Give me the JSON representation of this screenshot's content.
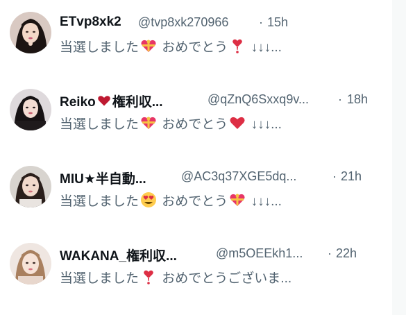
{
  "tweets": [
    {
      "name": "ETvp8xk2",
      "handle": "@tvp8xk270966",
      "separator": "·",
      "time": "15h",
      "text_a": "当選しました",
      "text_b": "おめでとう",
      "text_c": "↓↓↓...",
      "emoji_a": "gift-heart-icon",
      "emoji_b": "exclamation-heart-icon"
    },
    {
      "name": "Reiko",
      "name_suffix": "権利収...",
      "handle": "@qZnQ6Sxxq9v...",
      "separator": "·",
      "time": "18h",
      "text_a": "当選しました",
      "text_b": "おめでとう",
      "text_c": "↓↓↓...",
      "emoji_a": "gift-heart-icon",
      "emoji_b": "red-heart-icon"
    },
    {
      "name": "MIU★半自動...",
      "handle": "@AC3q37XGE5dq...",
      "separator": "·",
      "time": "21h",
      "text_a": "当選しました",
      "text_b": "おめでとう",
      "text_c": "↓↓↓...",
      "emoji_a": "heart-eyes-icon",
      "emoji_b": "gift-heart-icon"
    },
    {
      "name": "WAKANA_権利収...",
      "handle": "@m5OEEkh1...",
      "separator": "·",
      "time": "22h",
      "text_a": "当選しました",
      "text_b": "おめでとうございま...",
      "emoji_a": "exclamation-heart-icon"
    }
  ],
  "colors": {
    "name": "#0f1419",
    "secondary": "#536471",
    "heart": "#d9122f",
    "side_strip": "#f7f9f9"
  }
}
